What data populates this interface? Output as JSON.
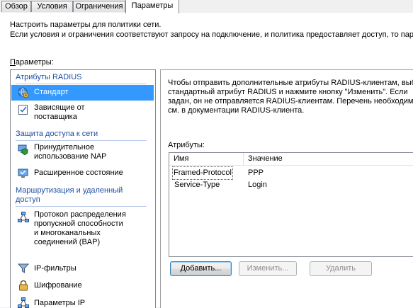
{
  "tabs": [
    {
      "label": "Обзор"
    },
    {
      "label": "Условия"
    },
    {
      "label": "Ограничения"
    },
    {
      "label": "Параметры",
      "active": true
    }
  ],
  "intro": {
    "line1": "Настроить параметры для политики сети.",
    "line2": "Если условия и ограничения соответствуют запросу на подключение, и политика предоставляет доступ, то пар"
  },
  "params_label_accel": "П",
  "params_label_rest": "араметры:",
  "nav": {
    "group1": "Атрибуты RADIUS",
    "group2": "Защита доступа к сети",
    "group3_line1": "Маршрутизация и удаленный",
    "group3_line2": "доступ",
    "items": [
      {
        "lines": [
          "Стандарт"
        ],
        "icon": "globe-gear-icon",
        "selected": true
      },
      {
        "lines": [
          "Зависящие от",
          "поставщика"
        ],
        "icon": "checklist-icon"
      },
      {
        "lines": [
          "Принудительное",
          "использование NAP"
        ],
        "icon": "computer-shield-icon"
      },
      {
        "lines": [
          "Расширенное состояние"
        ],
        "icon": "monitor-check-icon"
      },
      {
        "lines": [
          "Протокол распределения",
          "пропускной способности",
          "и многоканальных",
          "соединений (BAP)"
        ],
        "icon": "network-nodes-icon"
      },
      {
        "lines": [
          "IP-фильтры"
        ],
        "icon": "funnel-icon"
      },
      {
        "lines": [
          "Шифрование"
        ],
        "icon": "padlock-icon"
      },
      {
        "lines": [
          "Параметры IP"
        ],
        "icon": "network-nodes-icon"
      }
    ]
  },
  "details": {
    "desc": [
      "Чтобы отправить дополнительные атрибуты RADIUS-клиентам, выб",
      "стандартный атрибут RADIUS и нажмите кнопку \"Изменить\". Если",
      "задан, он не отправляется RADIUS-клиентам. Перечень необходим",
      "см. в документации RADIUS-клиента."
    ],
    "attributes_label": "Атрибуты:",
    "columns": [
      "Имя",
      "Значение"
    ],
    "rows": [
      {
        "name": "Framed-Protocol",
        "value": "PPP"
      },
      {
        "name": "Service-Type",
        "value": "Login"
      }
    ],
    "buttons": {
      "add": "Добавить...",
      "edit": "Изменить...",
      "remove": "Удалить"
    }
  },
  "colors": {
    "selection": "#3399ff",
    "group_header": "#1f4ea3"
  }
}
